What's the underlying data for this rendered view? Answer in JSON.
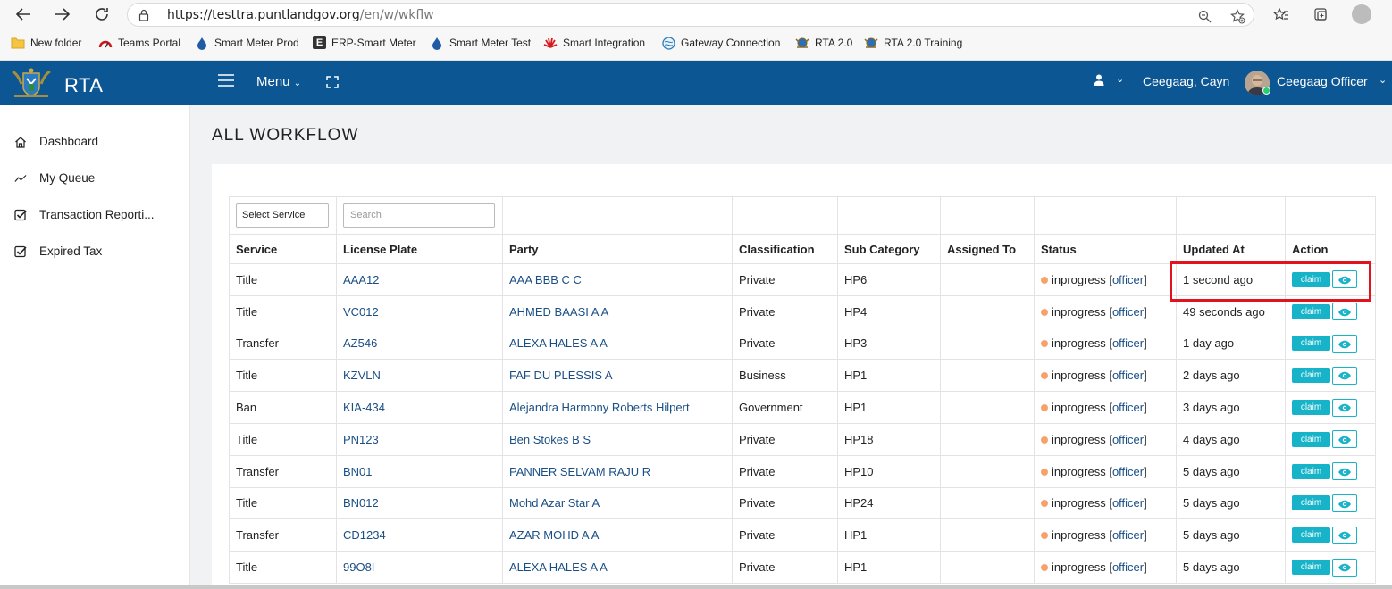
{
  "browser": {
    "url_host": "https://testtra.puntlandgov.org",
    "url_path": "/en/w/wkflw",
    "bookmarks": [
      {
        "label": "New folder",
        "icon": "folder-icon"
      },
      {
        "label": "Teams Portal",
        "icon": "teams-icon"
      },
      {
        "label": "Smart Meter Prod",
        "icon": "drop-icon"
      },
      {
        "label": "ERP-Smart Meter",
        "icon": "e-icon"
      },
      {
        "label": "Smart Meter Test",
        "icon": "drop-icon"
      },
      {
        "label": "Smart Integration",
        "icon": "huawei-icon"
      },
      {
        "label": "Gateway Connection",
        "icon": "globe-icon"
      },
      {
        "label": "RTA 2.0",
        "icon": "emblem-icon"
      },
      {
        "label": "RTA 2.0 Training",
        "icon": "emblem-icon"
      }
    ]
  },
  "header": {
    "brand": "RTA",
    "menu_label": "Menu",
    "user_name": "Ceegaag, Cayn",
    "role_name": "Ceegaag Officer",
    "colors": {
      "bar": "#0d5694"
    }
  },
  "sidebar": {
    "items": [
      {
        "label": "Dashboard",
        "icon": "home-icon"
      },
      {
        "label": "My Queue",
        "icon": "trend-icon"
      },
      {
        "label": "Transaction Reporti...",
        "icon": "checkbox-icon"
      },
      {
        "label": "Expired Tax",
        "icon": "checkbox-icon"
      }
    ]
  },
  "page": {
    "title": "ALL WORKFLOW"
  },
  "filters": {
    "service_select": "Select Service",
    "search_placeholder": "Search"
  },
  "table": {
    "columns": [
      "Service",
      "License Plate",
      "Party",
      "Classification",
      "Sub Category",
      "Assigned To",
      "Status",
      "Updated At",
      "Action"
    ],
    "claim_label": "claim",
    "rows": [
      {
        "service": "Title",
        "plate": "AAA12",
        "party": "AAA BBB C C",
        "classification": "Private",
        "sub": "HP6",
        "assigned": "",
        "status": "inprogress",
        "role": "officer",
        "updated": "1 second ago"
      },
      {
        "service": "Title",
        "plate": "VC012",
        "party": "AHMED BAASI A A",
        "classification": "Private",
        "sub": "HP4",
        "assigned": "",
        "status": "inprogress",
        "role": "officer",
        "updated": "49 seconds ago"
      },
      {
        "service": "Transfer",
        "plate": "AZ546",
        "party": "ALEXA HALES A A",
        "classification": "Private",
        "sub": "HP3",
        "assigned": "",
        "status": "inprogress",
        "role": "officer",
        "updated": "1 day ago"
      },
      {
        "service": "Title",
        "plate": "KZVLN",
        "party": "FAF DU PLESSIS A",
        "classification": "Business",
        "sub": "HP1",
        "assigned": "",
        "status": "inprogress",
        "role": "officer",
        "updated": "2 days ago"
      },
      {
        "service": "Ban",
        "plate": "KIA-434",
        "party": "Alejandra Harmony Roberts Hilpert",
        "classification": "Government",
        "sub": "HP1",
        "assigned": "",
        "status": "inprogress",
        "role": "officer",
        "updated": "3 days ago"
      },
      {
        "service": "Title",
        "plate": "PN123",
        "party": "Ben Stokes B S",
        "classification": "Private",
        "sub": "HP18",
        "assigned": "",
        "status": "inprogress",
        "role": "officer",
        "updated": "4 days ago"
      },
      {
        "service": "Transfer",
        "plate": "BN01",
        "party": "PANNER SELVAM RAJU R",
        "classification": "Private",
        "sub": "HP10",
        "assigned": "",
        "status": "inprogress",
        "role": "officer",
        "updated": "5 days ago"
      },
      {
        "service": "Title",
        "plate": "BN012",
        "party": "Mohd Azar Star A",
        "classification": "Private",
        "sub": "HP24",
        "assigned": "",
        "status": "inprogress",
        "role": "officer",
        "updated": "5 days ago"
      },
      {
        "service": "Transfer",
        "plate": "CD1234",
        "party": "AZAR MOHD A A",
        "classification": "Private",
        "sub": "HP1",
        "assigned": "",
        "status": "inprogress",
        "role": "officer",
        "updated": "5 days ago"
      },
      {
        "service": "Title",
        "plate": "99O8I",
        "party": "ALEXA HALES A A",
        "classification": "Private",
        "sub": "HP1",
        "assigned": "",
        "status": "inprogress",
        "role": "officer",
        "updated": "5 days ago"
      }
    ]
  }
}
